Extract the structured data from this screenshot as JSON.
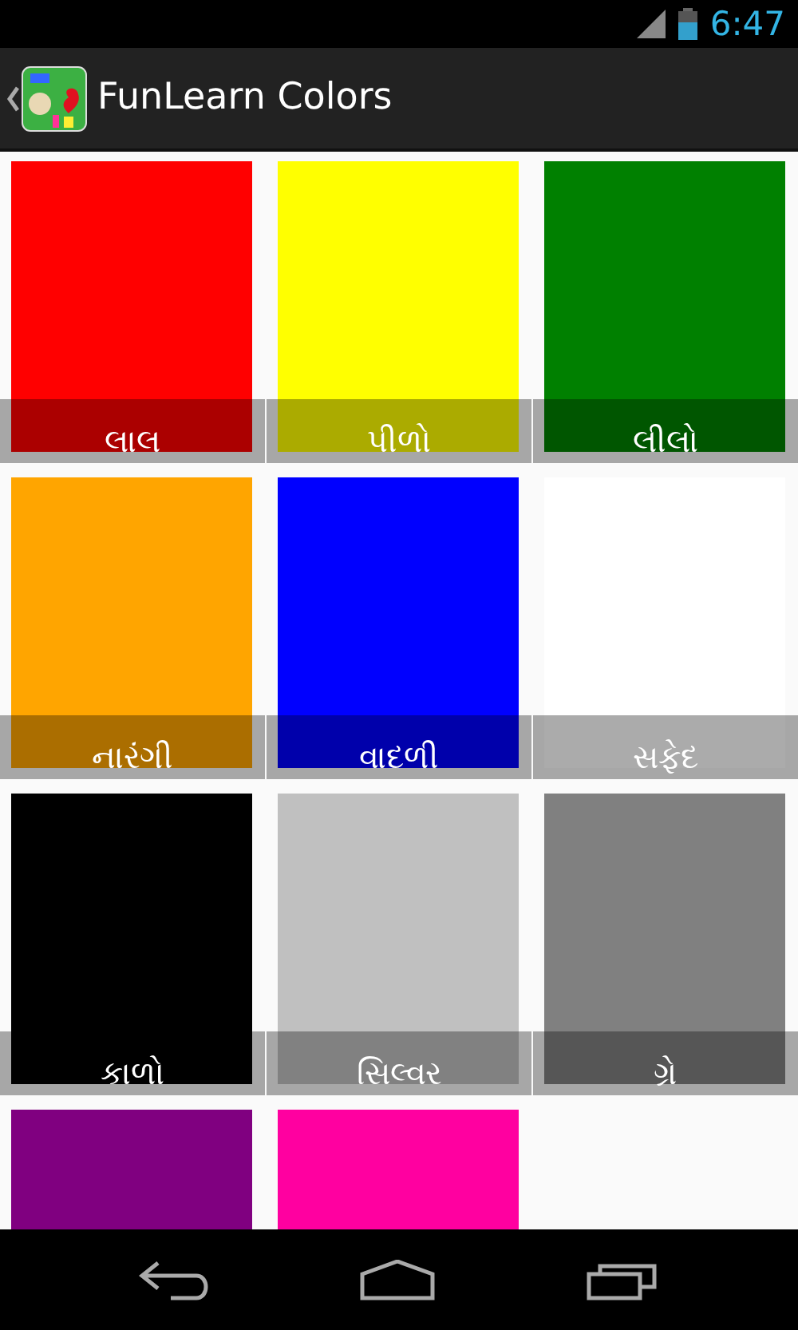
{
  "status_bar": {
    "time": "6:47"
  },
  "app_bar": {
    "title": "FunLearn Colors"
  },
  "colors": [
    {
      "name": "લાલ",
      "color": "#ff0000"
    },
    {
      "name": "પીળો",
      "color": "#ffff00"
    },
    {
      "name": "લીલો",
      "color": "#008000"
    },
    {
      "name": "નારંગી",
      "color": "#ffa500"
    },
    {
      "name": "વાદળી",
      "color": "#0000ff"
    },
    {
      "name": "સફેદ",
      "color": "#ffffff"
    },
    {
      "name": "કાળો",
      "color": "#000000"
    },
    {
      "name": "સિલ્વર",
      "color": "#c0c0c0"
    },
    {
      "name": "ગ્રે",
      "color": "#808080"
    },
    {
      "color": "#800080"
    },
    {
      "color": "#ff00a0"
    }
  ]
}
